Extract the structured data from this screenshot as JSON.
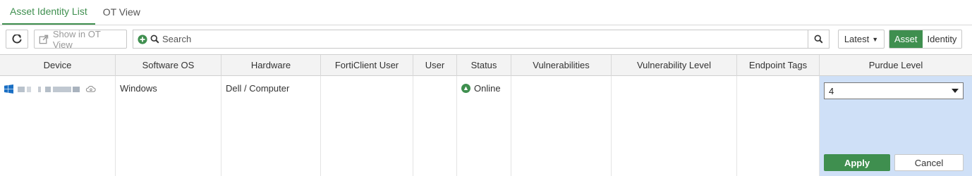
{
  "tabs": [
    {
      "label": "Asset Identity List",
      "active": true
    },
    {
      "label": "OT View",
      "active": false
    }
  ],
  "toolbar": {
    "refresh_icon": "refresh-icon",
    "show_ot_label": "Show in OT View",
    "search_placeholder": "Search",
    "latest_label": "Latest",
    "toggle": {
      "asset": "Asset",
      "identity": "Identity",
      "selected": "Asset"
    }
  },
  "table": {
    "columns": [
      "Device",
      "Software OS",
      "Hardware",
      "FortiClient User",
      "User",
      "Status",
      "Vulnerabilities",
      "Vulnerability Level",
      "Endpoint Tags",
      "Purdue Level"
    ],
    "rows": [
      {
        "device_icon": "windows-icon",
        "software_os": "Windows",
        "hardware": "Dell / Computer",
        "forticlient_user": "",
        "user": "",
        "status": "Online",
        "vulnerabilities": "",
        "vulnerability_level": "",
        "endpoint_tags": "",
        "purdue_level": "4"
      }
    ]
  },
  "editor": {
    "apply_label": "Apply",
    "cancel_label": "Cancel"
  },
  "colors": {
    "accent_green": "#3f8f4f",
    "edit_highlight": "#cfe0f7"
  }
}
